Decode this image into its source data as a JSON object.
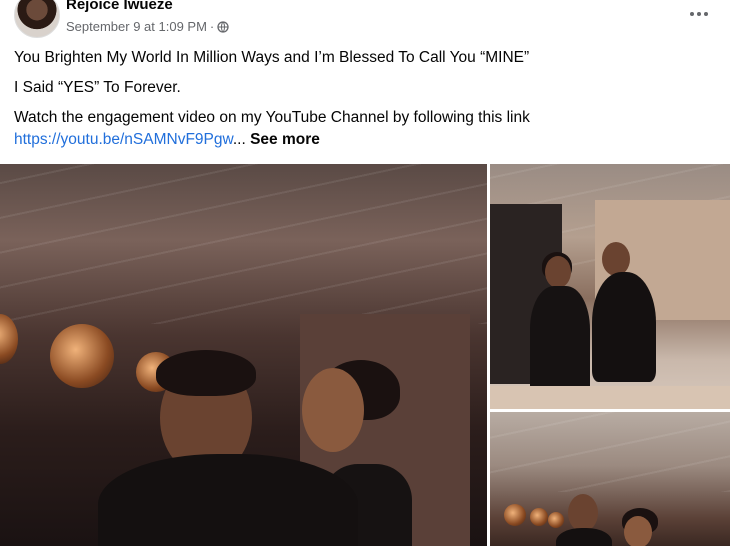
{
  "post": {
    "author": "Rejoice Iwueze",
    "timestamp": "September 9 at 1:09 PM",
    "separator": "·",
    "privacy_icon": "globe-icon",
    "more_icon": "more-options-icon",
    "lines": [
      "You Brighten My World In Million Ways and I’m Blessed To Call You “MINE”",
      "I Said “YES” To Forever.",
      "Watch the engagement video on my YouTube Channel by following this link"
    ],
    "link_text": "https://youtu.be/nSAMNvF9Pgw",
    "ellipsis": "...",
    "see_more": "See more"
  },
  "colors": {
    "link": "#216fdb",
    "meta": "#65676b",
    "text": "#050505"
  }
}
